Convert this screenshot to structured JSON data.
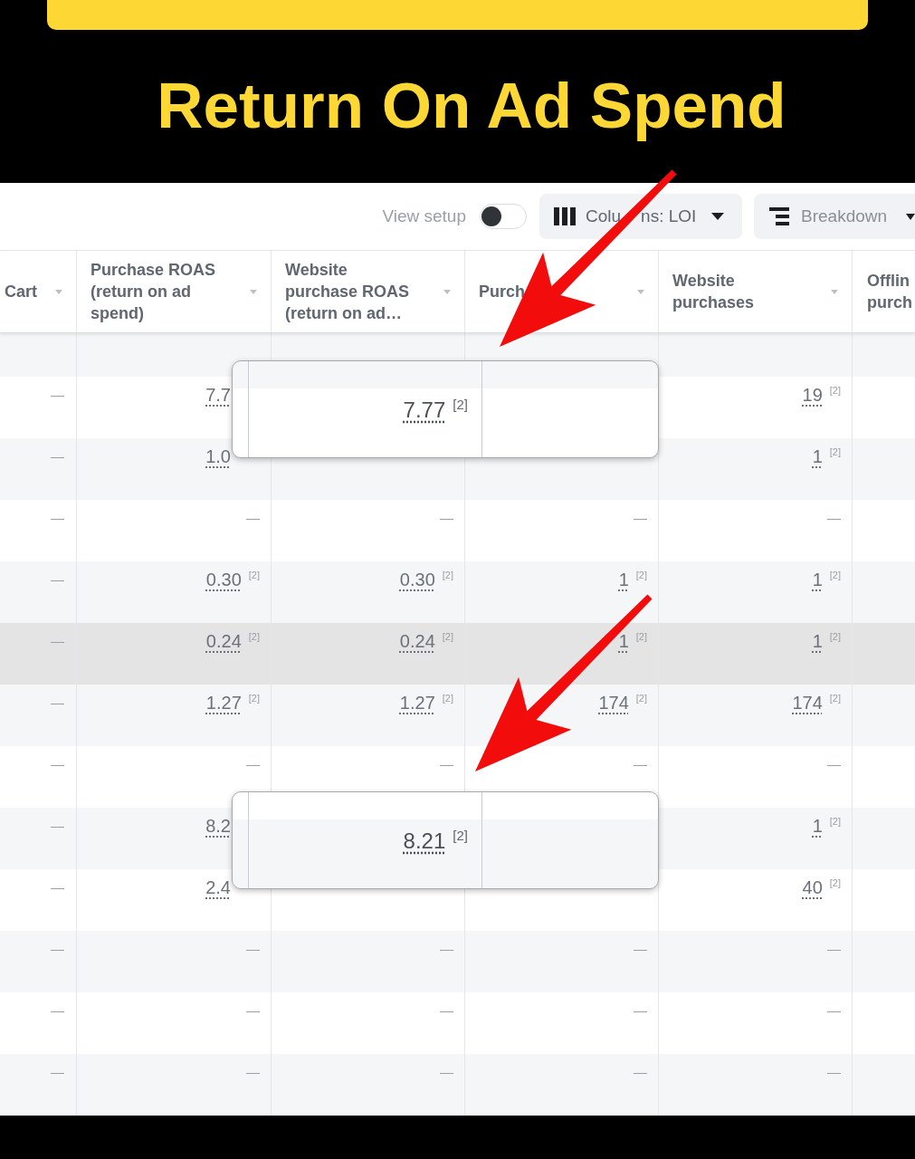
{
  "title": "Return On Ad Spend",
  "toolbar": {
    "view_setup": {
      "label": "View setup",
      "on": false
    },
    "columns_button": {
      "label_parts": [
        "Colu",
        "ns: LOI"
      ]
    },
    "breakdown_button": {
      "label": "Breakdown"
    }
  },
  "table": {
    "columns": [
      {
        "label": "Cart",
        "dropdown": true
      },
      {
        "label": "Purchase ROAS (return on ad spend)",
        "dropdown": true
      },
      {
        "label": "Website purchase ROAS (return on ad…",
        "dropdown": true
      },
      {
        "label": "Purch",
        "dropdown": true
      },
      {
        "label": "Website purchases",
        "dropdown": true
      },
      {
        "label": "Offlin purch",
        "dropdown": false
      }
    ],
    "rows": [
      {
        "kind": "cut",
        "highlighted": false
      },
      {
        "kind": "full",
        "highlighted": false,
        "cells": [
          {
            "value": "—"
          },
          {
            "value": "7.7"
          },
          null,
          null,
          {
            "value": "19",
            "note": "[2]"
          }
        ],
        "callout": {
          "value": "7.77",
          "note": "[2]"
        }
      },
      {
        "kind": "full",
        "highlighted": false,
        "cells": [
          {
            "value": "—"
          },
          {
            "value": "1.0"
          },
          null,
          null,
          {
            "value": "1",
            "note": "[2]"
          }
        ]
      },
      {
        "kind": "full",
        "highlighted": false,
        "cells": [
          {
            "value": "—"
          },
          {
            "value": "—"
          },
          {
            "value": "—"
          },
          {
            "value": "—"
          },
          {
            "value": "—"
          }
        ]
      },
      {
        "kind": "full",
        "highlighted": false,
        "cells": [
          {
            "value": "—"
          },
          {
            "value": "0.30",
            "note": "[2]"
          },
          {
            "value": "0.30",
            "note": "[2]"
          },
          {
            "value": "1",
            "note": "[2]"
          },
          {
            "value": "1",
            "note": "[2]"
          }
        ]
      },
      {
        "kind": "full",
        "highlighted": true,
        "cells": [
          {
            "value": "—"
          },
          {
            "value": "0.24",
            "note": "[2]"
          },
          {
            "value": "0.24",
            "note": "[2]"
          },
          {
            "value": "1",
            "note": "[2]"
          },
          {
            "value": "1",
            "note": "[2]"
          }
        ]
      },
      {
        "kind": "full",
        "highlighted": false,
        "cells": [
          {
            "value": "—"
          },
          {
            "value": "1.27",
            "note": "[2]"
          },
          {
            "value": "1.27",
            "note": "[2]"
          },
          {
            "value": "174",
            "note": "[2]"
          },
          {
            "value": "174",
            "note": "[2]"
          }
        ]
      },
      {
        "kind": "full",
        "highlighted": false,
        "cells": [
          {
            "value": "—"
          },
          {
            "value": "—"
          },
          {
            "value": "—"
          },
          {
            "value": "—"
          },
          {
            "value": "—"
          }
        ]
      },
      {
        "kind": "full",
        "highlighted": false,
        "cells": [
          {
            "value": "—"
          },
          {
            "value": "8.2"
          },
          null,
          null,
          {
            "value": "1",
            "note": "[2]"
          }
        ],
        "callout": {
          "value": "8.21",
          "note": "[2]"
        }
      },
      {
        "kind": "full",
        "highlighted": false,
        "cells": [
          {
            "value": "—"
          },
          {
            "value": "2.4"
          },
          null,
          null,
          {
            "value": "40",
            "note": "[2]"
          }
        ]
      },
      {
        "kind": "full",
        "highlighted": false,
        "cells": [
          {
            "value": "—"
          },
          {
            "value": "—"
          },
          {
            "value": "—"
          },
          {
            "value": "—"
          },
          {
            "value": "—"
          }
        ]
      },
      {
        "kind": "full",
        "highlighted": false,
        "cells": [
          {
            "value": "—"
          },
          {
            "value": "—"
          },
          {
            "value": "—"
          },
          {
            "value": "—"
          },
          {
            "value": "—"
          }
        ]
      },
      {
        "kind": "full",
        "highlighted": false,
        "cells": [
          {
            "value": "—"
          },
          {
            "value": "—"
          },
          {
            "value": "—"
          },
          {
            "value": "—"
          },
          {
            "value": "—"
          }
        ]
      }
    ]
  }
}
